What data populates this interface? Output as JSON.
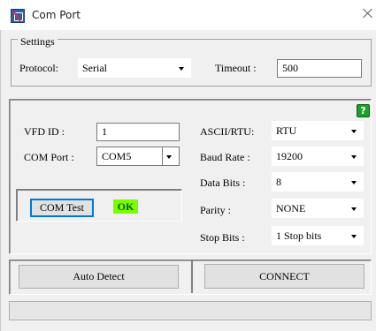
{
  "window": {
    "title": "Com Port",
    "icon": "com-port-app-icon",
    "close_icon": "close-icon"
  },
  "settings": {
    "group_label": "Settings",
    "protocol_label": "Protocol:",
    "protocol_value": "Serial",
    "timeout_label": "Timeout :",
    "timeout_value": "500"
  },
  "device": {
    "vfd_id_label": "VFD ID :",
    "vfd_id_value": "1",
    "com_port_label": "COM Port :",
    "com_port_value": "COM5",
    "com_test_button": "COM Test",
    "status_text": "OK",
    "help_icon_glyph": "?",
    "colors": {
      "ok_badge": "#7cfc00",
      "help_icon": "#1e9e2a",
      "focus_border": "#0078d7"
    }
  },
  "serial": {
    "ascii_rtu_label": "ASCII/RTU:",
    "ascii_rtu_value": "RTU",
    "baud_rate_label": "Baud Rate :",
    "baud_rate_value": "19200",
    "data_bits_label": "Data Bits :",
    "data_bits_value": "8",
    "parity_label": "Parity :",
    "parity_value": "NONE",
    "stop_bits_label": "Stop Bits :",
    "stop_bits_value": "1 Stop bits"
  },
  "actions": {
    "auto_detect_button": "Auto Detect",
    "connect_button": "CONNECT"
  },
  "status_bar": {
    "text": ""
  }
}
